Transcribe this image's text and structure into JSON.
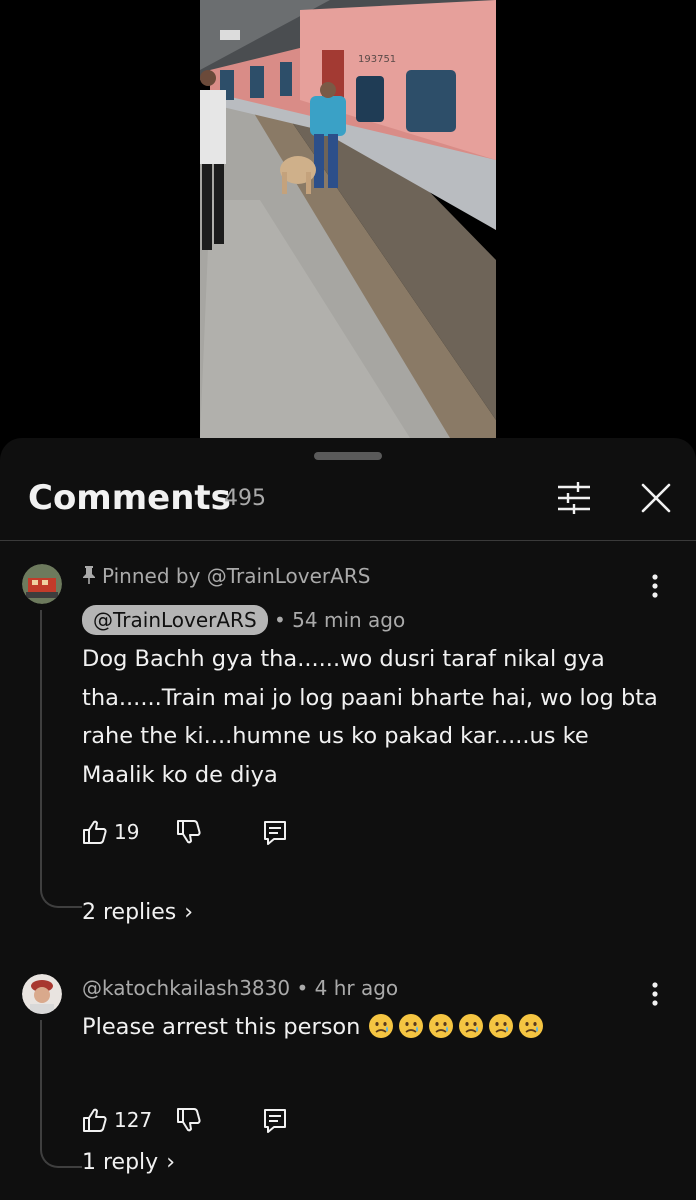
{
  "header": {
    "title": "Comments",
    "count": "495",
    "filter_icon": "sliders-icon",
    "close_icon": "close-icon"
  },
  "video": {
    "train_number": "193751"
  },
  "comments": [
    {
      "pinned_label": "Pinned by @TrainLoverARS",
      "author": "@TrainLoverARS",
      "time": "• 54 min ago",
      "text": "Dog Bachh gya tha......wo dusri taraf nikal gya tha......Train mai jo log paani bharte hai, wo log bta rahe the ki....humne us ko pakad kar.....us ke Maalik ko de diya",
      "likes": "19",
      "replies": "2 replies"
    },
    {
      "author": "@katochkailash3830",
      "time": "• 4 hr ago",
      "text": "Please  arrest this person",
      "emoji_count": 6,
      "likes": "127",
      "replies": "1 reply"
    }
  ],
  "colors": {
    "background": "#0f0f0f",
    "text": "#f1f1f1",
    "secondary": "#aaaaaa",
    "chip": "#b5b5b5"
  }
}
